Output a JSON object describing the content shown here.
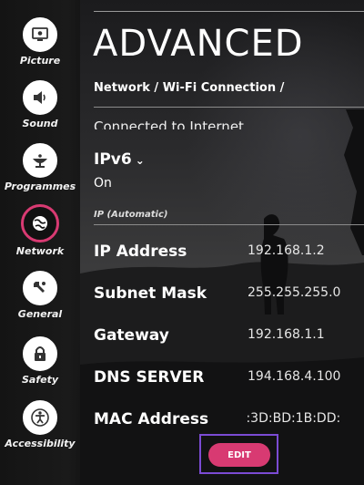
{
  "sidebar": {
    "items": [
      {
        "label": "Picture",
        "icon": "picture-icon"
      },
      {
        "label": "Sound",
        "icon": "speaker-icon"
      },
      {
        "label": "Programmes",
        "icon": "satellite-dish-icon"
      },
      {
        "label": "Network",
        "icon": "globe-icon",
        "active": true
      },
      {
        "label": "General",
        "icon": "wrench-icon"
      },
      {
        "label": "Safety",
        "icon": "lock-icon"
      },
      {
        "label": "Accessibility",
        "icon": "accessibility-icon"
      }
    ]
  },
  "header": {
    "title": "ADVANCED",
    "breadcrumb": "Network / Wi-Fi Connection /"
  },
  "status": {
    "connected": "Connected to Internet"
  },
  "ipv6": {
    "label": "IPv6",
    "value": "On"
  },
  "section_label": "IP (Automatic)",
  "rows": [
    {
      "label": "IP Address",
      "value": "192.168.1.2"
    },
    {
      "label": "Subnet Mask",
      "value": "255.255.255.0"
    },
    {
      "label": "Gateway",
      "value": "192.168.1.1"
    },
    {
      "label": "DNS SERVER",
      "value": "194.168.4.100"
    },
    {
      "label": "MAC Address",
      "value": "):3D:BD:1B:DD:"
    }
  ],
  "edit_button": {
    "label": "EDIT"
  },
  "colors": {
    "accent": "#d83a72",
    "focus_outline": "#7b4bd4",
    "sidebar_bg": "#141414"
  }
}
